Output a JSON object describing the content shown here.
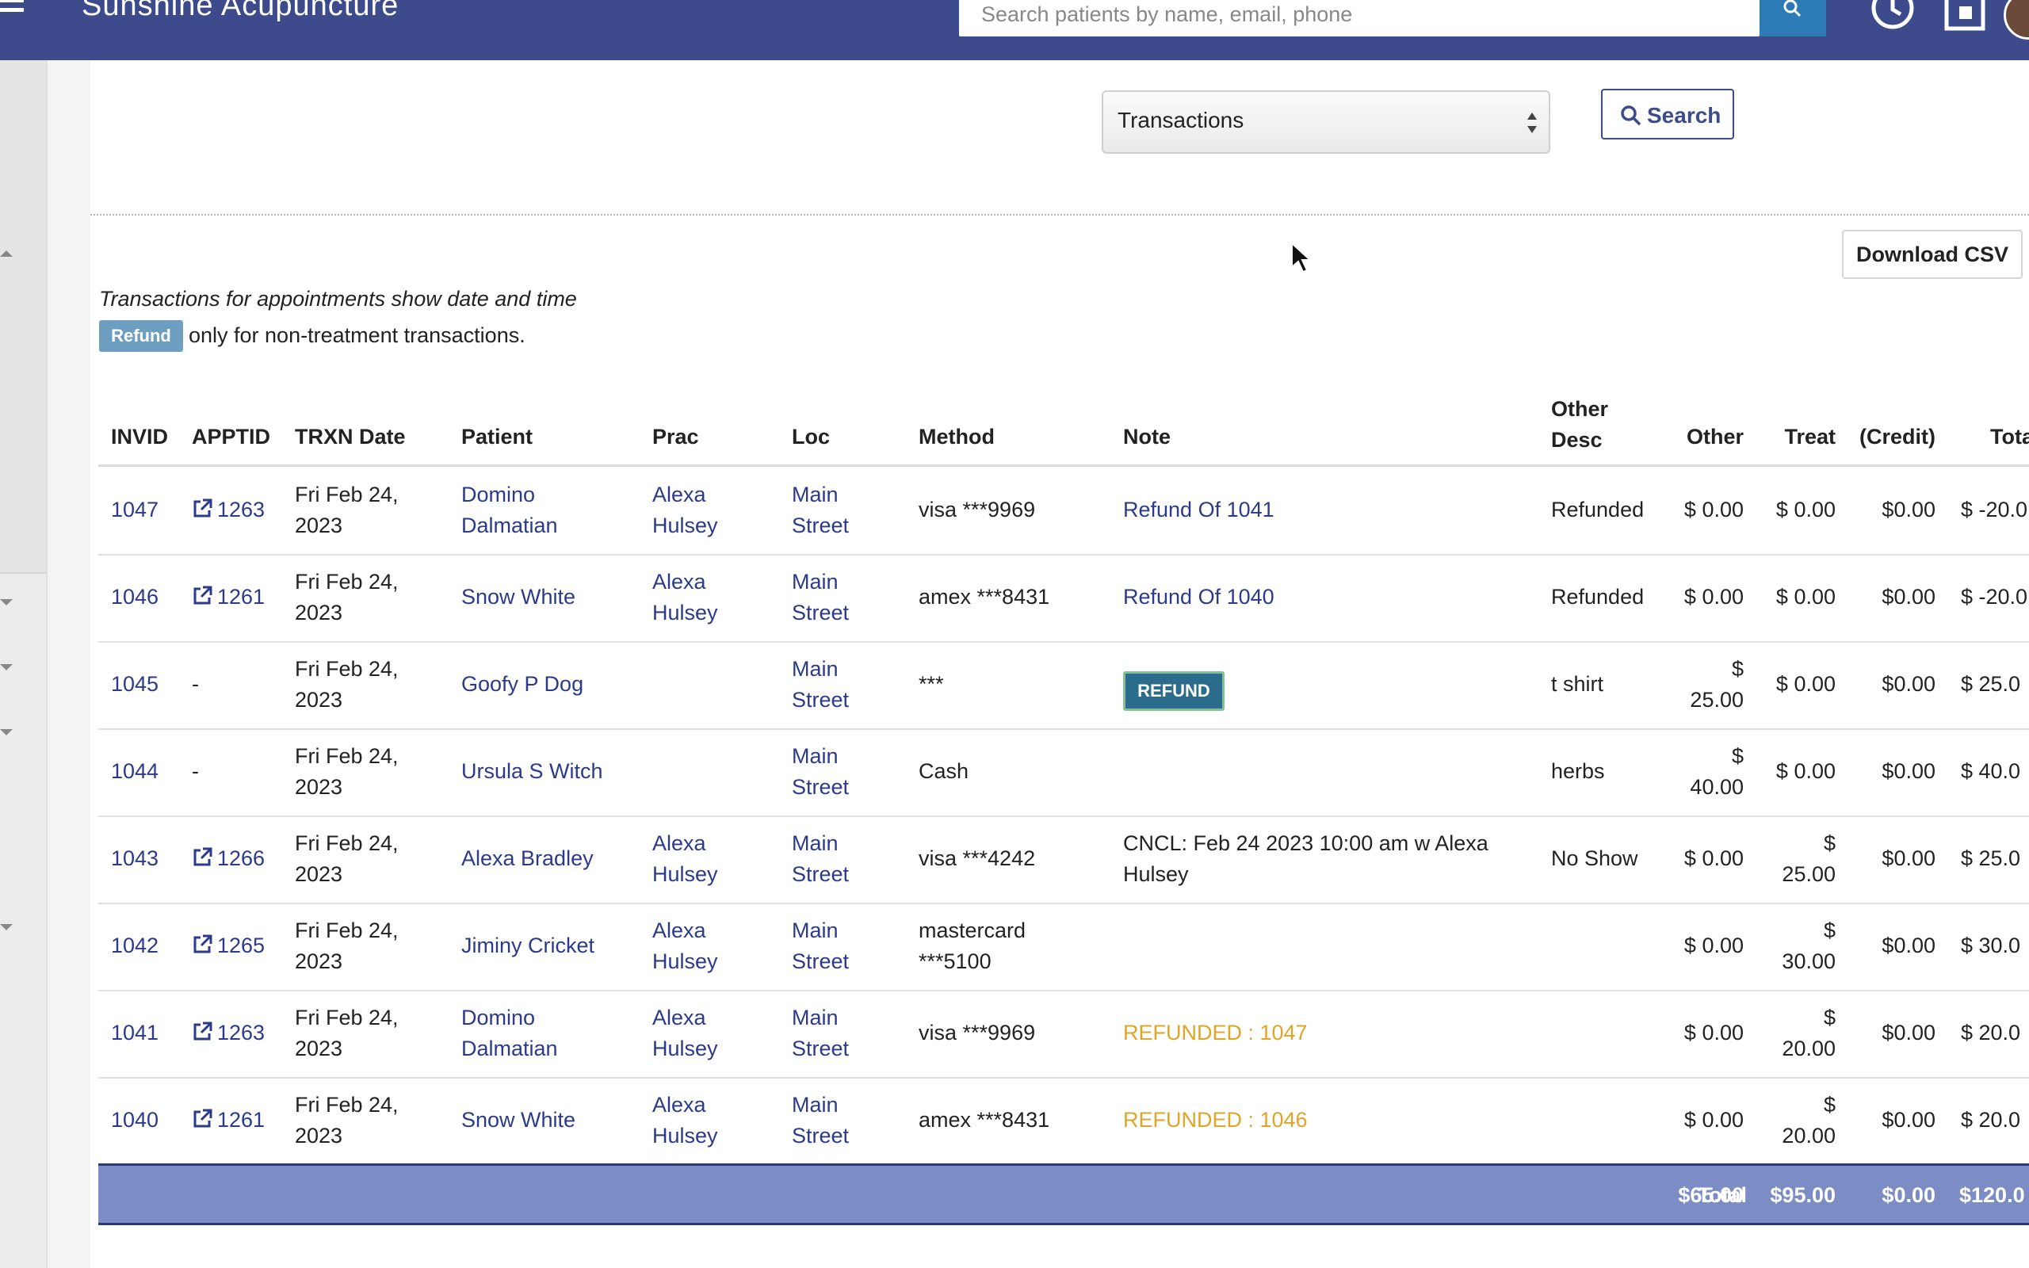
{
  "header": {
    "app_title": "Sunshine Acupuncture",
    "search_placeholder": "Search patients by name, email, phone"
  },
  "toolbar": {
    "report_type": "Transactions",
    "search_label": "Search",
    "download_csv_label": "Download CSV"
  },
  "info": {
    "line1": "Transactions for appointments show date and time",
    "refund_badge": "Refund",
    "line2": "only for non-treatment transactions."
  },
  "table": {
    "columns": {
      "invid": "INVID",
      "apptid": "APPTID",
      "trxn_date": "TRXN Date",
      "patient": "Patient",
      "prac": "Prac",
      "loc": "Loc",
      "method": "Method",
      "note": "Note",
      "other_desc_1": "Other",
      "other_desc_2": "Desc",
      "other": "Other",
      "treat": "Treat",
      "credit": "(Credit)",
      "total": "Tota"
    },
    "rows": [
      {
        "invid": "1047",
        "apptid": "1263",
        "date1": "Fri Feb 24,",
        "date2": "2023",
        "patient1": "Domino",
        "patient2": "Dalmatian",
        "prac1": "Alexa",
        "prac2": "Hulsey",
        "loc1": "Main",
        "loc2": "Street",
        "method1": "visa ***9969",
        "method2": "",
        "note1": "Refund Of 1041",
        "note2": "",
        "note_style": "link",
        "desc": "Refunded",
        "other1": "$ 0.00",
        "other2": "",
        "treat1": "$ 0.00",
        "treat2": "",
        "credit": "$0.00",
        "total": "$ -20.0"
      },
      {
        "invid": "1046",
        "apptid": "1261",
        "date1": "Fri Feb 24,",
        "date2": "2023",
        "patient1": "Snow White",
        "patient2": "",
        "prac1": "Alexa",
        "prac2": "Hulsey",
        "loc1": "Main",
        "loc2": "Street",
        "method1": "amex ***8431",
        "method2": "",
        "note1": "Refund Of 1040",
        "note2": "",
        "note_style": "link",
        "desc": "Refunded",
        "other1": "$ 0.00",
        "other2": "",
        "treat1": "$ 0.00",
        "treat2": "",
        "credit": "$0.00",
        "total": "$ -20.0"
      },
      {
        "invid": "1045",
        "apptid": "-",
        "date1": "Fri Feb 24,",
        "date2": "2023",
        "patient1": "Goofy P Dog",
        "patient2": "",
        "prac1": "",
        "prac2": "",
        "loc1": "Main",
        "loc2": "Street",
        "method1": "***",
        "method2": "",
        "note1": "REFUND",
        "note2": "",
        "note_style": "button",
        "desc": "t shirt",
        "other1": "$",
        "other2": "25.00",
        "treat1": "$ 0.00",
        "treat2": "",
        "credit": "$0.00",
        "total": "$ 25.0"
      },
      {
        "invid": "1044",
        "apptid": "-",
        "date1": "Fri Feb 24,",
        "date2": "2023",
        "patient1": "Ursula S Witch",
        "patient2": "",
        "prac1": "",
        "prac2": "",
        "loc1": "Main",
        "loc2": "Street",
        "method1": "Cash",
        "method2": "",
        "note1": "",
        "note2": "",
        "note_style": "text",
        "desc": "herbs",
        "other1": "$",
        "other2": "40.00",
        "treat1": "$ 0.00",
        "treat2": "",
        "credit": "$0.00",
        "total": "$ 40.0"
      },
      {
        "invid": "1043",
        "apptid": "1266",
        "date1": "Fri Feb 24,",
        "date2": "2023",
        "patient1": "Alexa Bradley",
        "patient2": "",
        "prac1": "Alexa",
        "prac2": "Hulsey",
        "loc1": "Main",
        "loc2": "Street",
        "method1": "visa ***4242",
        "method2": "",
        "note1": "CNCL: Feb 24 2023 10:00 am w Alexa",
        "note2": "Hulsey",
        "note_style": "text",
        "desc": "No Show",
        "other1": "$ 0.00",
        "other2": "",
        "treat1": "$",
        "treat2": "25.00",
        "credit": "$0.00",
        "total": "$ 25.0"
      },
      {
        "invid": "1042",
        "apptid": "1265",
        "date1": "Fri Feb 24,",
        "date2": "2023",
        "patient1": "Jiminy Cricket",
        "patient2": "",
        "prac1": "Alexa",
        "prac2": "Hulsey",
        "loc1": "Main",
        "loc2": "Street",
        "method1": "mastercard",
        "method2": "***5100",
        "note1": "",
        "note2": "",
        "note_style": "text",
        "desc": "",
        "other1": "$ 0.00",
        "other2": "",
        "treat1": "$",
        "treat2": "30.00",
        "credit": "$0.00",
        "total": "$ 30.0"
      },
      {
        "invid": "1041",
        "apptid": "1263",
        "date1": "Fri Feb 24,",
        "date2": "2023",
        "patient1": "Domino",
        "patient2": "Dalmatian",
        "prac1": "Alexa",
        "prac2": "Hulsey",
        "loc1": "Main",
        "loc2": "Street",
        "method1": "visa ***9969",
        "method2": "",
        "note1": "REFUNDED : 1047",
        "note2": "",
        "note_style": "gold",
        "desc": "",
        "other1": "$ 0.00",
        "other2": "",
        "treat1": "$",
        "treat2": "20.00",
        "credit": "$0.00",
        "total": "$ 20.0"
      },
      {
        "invid": "1040",
        "apptid": "1261",
        "date1": "Fri Feb 24,",
        "date2": "2023",
        "patient1": "Snow White",
        "patient2": "",
        "prac1": "Alexa",
        "prac2": "Hulsey",
        "loc1": "Main",
        "loc2": "Street",
        "method1": "amex ***8431",
        "method2": "",
        "note1": "REFUNDED : 1046",
        "note2": "",
        "note_style": "gold",
        "desc": "",
        "other1": "$ 0.00",
        "other2": "",
        "treat1": "$",
        "treat2": "20.00",
        "credit": "$0.00",
        "total": "$ 20.0"
      }
    ],
    "totals": {
      "label": "Total",
      "other": "$65.00",
      "treat": "$95.00",
      "credit": "$0.00",
      "total": "$120.0"
    }
  },
  "colors": {
    "topbar": "#3d4a8c",
    "link": "#2b3a8c",
    "refunded_note": "#e0a526",
    "total_bar": "#7b8dc4"
  }
}
